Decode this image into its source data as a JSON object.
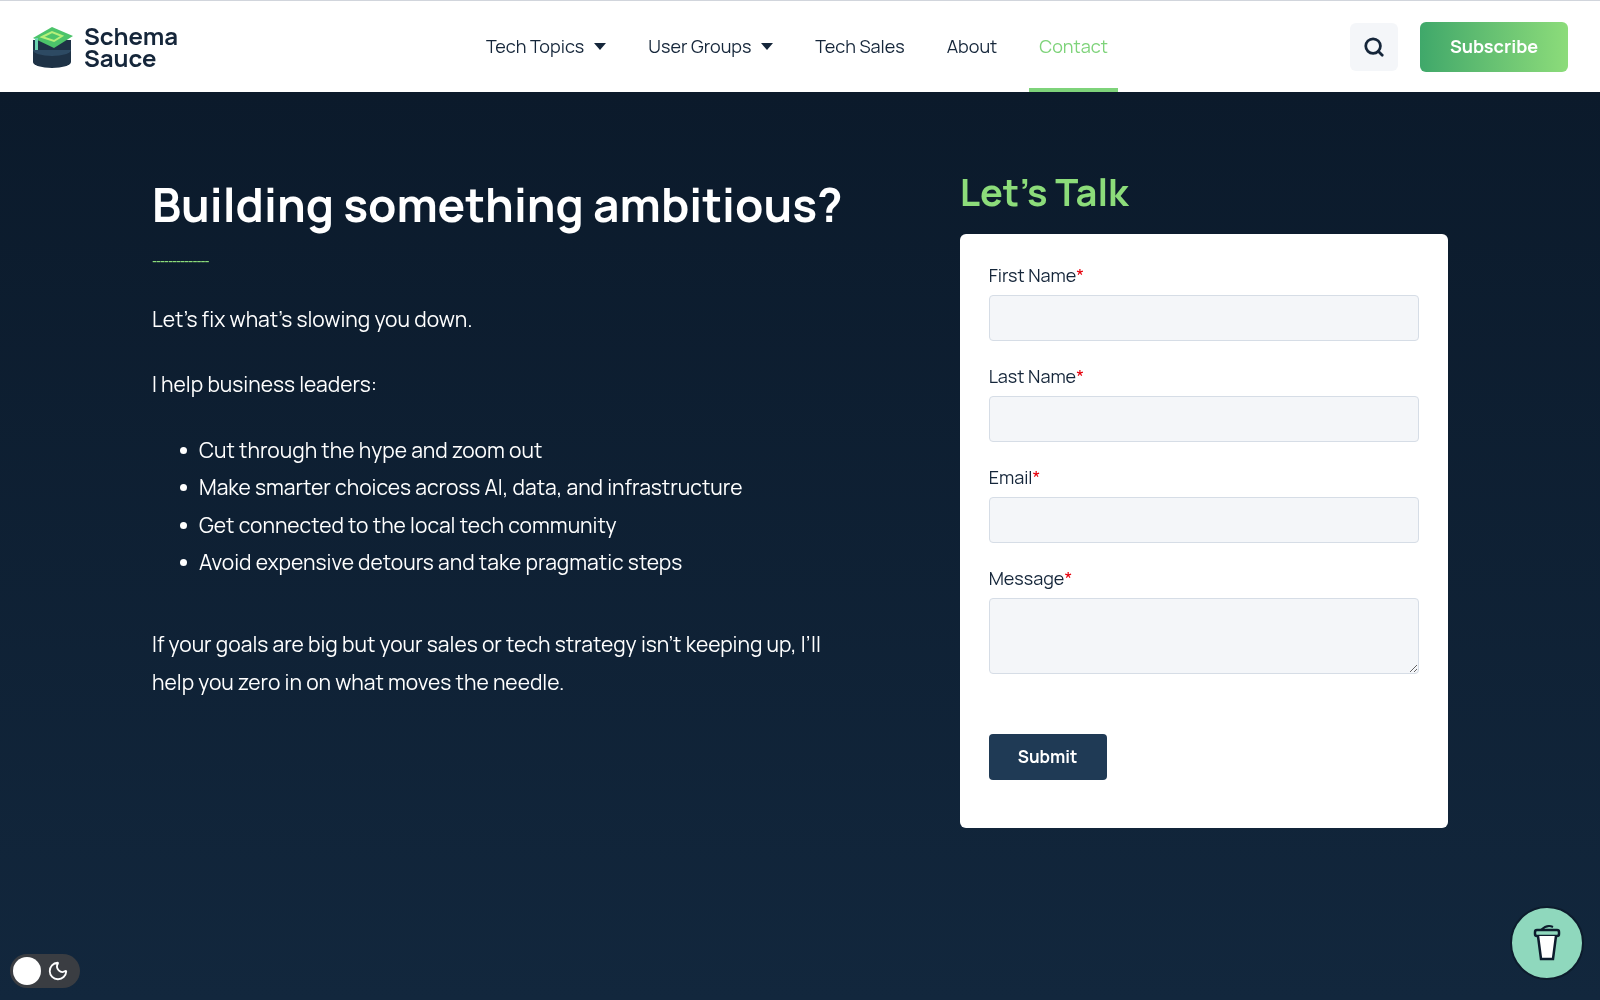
{
  "header": {
    "logo_text": [
      "Schema",
      "Sauce"
    ],
    "nav": [
      {
        "label": "Tech Topics",
        "dropdown": true,
        "selected": false
      },
      {
        "label": "User Groups",
        "dropdown": true,
        "selected": false
      },
      {
        "label": "Tech Sales",
        "dropdown": false,
        "selected": false
      },
      {
        "label": "About",
        "dropdown": false,
        "selected": false
      },
      {
        "label": "Contact",
        "dropdown": false,
        "selected": true
      }
    ],
    "subscribe": "Subscribe"
  },
  "intro": {
    "heading": "Building something ambitious?",
    "divider": "--------------",
    "lead": "Let’s fix what’s slowing you down.",
    "list_intro": "I help business leaders:",
    "bullets": [
      "Cut through the hype and zoom out",
      "Make smarter choices across AI, data, and infrastructure",
      "Get connected to the local tech community",
      "Avoid expensive detours and take pragmatic steps"
    ],
    "closing": "If your goals are big but your sales or tech strategy isn’t keeping up, I’ll help you zero in on what moves the needle."
  },
  "form": {
    "title": "Let’s Talk",
    "fields": [
      {
        "label": "First Name",
        "required": true,
        "kind": "input"
      },
      {
        "label": "Last Name",
        "required": true,
        "kind": "input"
      },
      {
        "label": "Email",
        "required": true,
        "kind": "input"
      },
      {
        "label": "Message",
        "required": true,
        "kind": "textarea"
      }
    ],
    "required_mark": "*",
    "submit": "Submit"
  },
  "theme_toggle": {
    "on": false
  }
}
